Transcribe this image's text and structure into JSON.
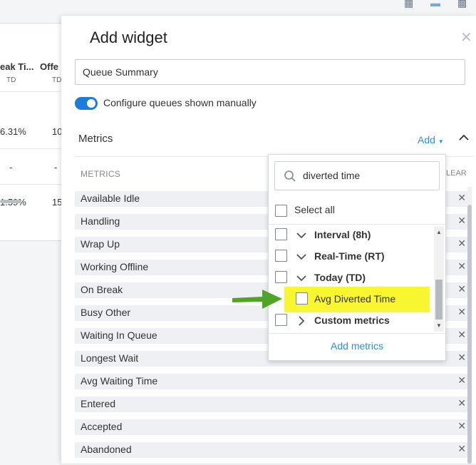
{
  "background": {
    "columns": [
      {
        "header": "eak Ti...",
        "sub": "TD",
        "cells": [
          "6.31%",
          "-",
          "1.59%"
        ]
      },
      {
        "header": "Offe",
        "sub": "TD",
        "cells": [
          "10",
          "-",
          "15"
        ]
      }
    ]
  },
  "modal": {
    "title": "Add widget",
    "name_value": "Queue Summary",
    "toggle_label": "Configure queues shown manually",
    "metrics_title": "Metrics",
    "add_label": "Add",
    "column_header": "METRICS",
    "clear_header": "LEAR",
    "metrics": [
      "Available Idle",
      "Handling",
      "Wrap Up",
      "Working Offline",
      "On Break",
      "Busy Other",
      "Waiting In Queue",
      "Longest Wait",
      "Avg Waiting Time",
      "Entered",
      "Accepted",
      "Abandoned"
    ]
  },
  "dropdown": {
    "search_value": "diverted time",
    "select_all_label": "Select all",
    "groups": [
      {
        "label": "Interval (8h)",
        "expanded": true
      },
      {
        "label": "Real-Time (RT)",
        "expanded": true
      },
      {
        "label": "Today (TD)",
        "expanded": true
      }
    ],
    "leaf": "Avg Diverted Time",
    "custom_group": "Custom metrics",
    "footer_label": "Add metrics"
  },
  "colors": {
    "accent": "#2a8fe6",
    "toggle": "#1e7bd9",
    "highlight": "#f8f531",
    "arrow": "#4ea526"
  }
}
